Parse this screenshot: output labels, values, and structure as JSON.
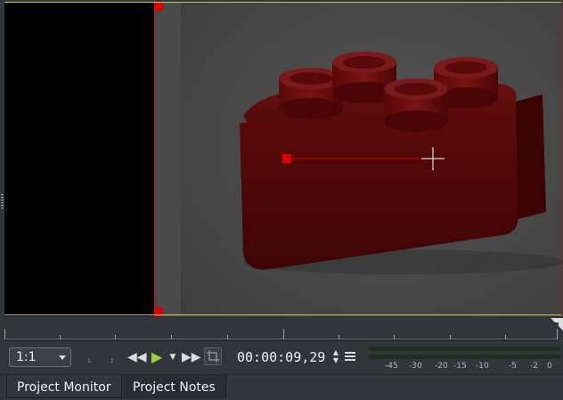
{
  "monitor": {
    "background_color": "#4a4a4a",
    "crop_edge_color": "#cc0000",
    "subject_color": "#6a0a0a"
  },
  "toolbar": {
    "zoom": "1:1",
    "timecode": "00:00:09,29",
    "icons": [
      "zone-in-icon",
      "zone-out-icon",
      "rewind-icon",
      "play-icon",
      "play-options-icon",
      "fast-forward-icon",
      "crop-icon",
      "spin-up-icon",
      "spin-down-icon",
      "menu-icon"
    ]
  },
  "audio_meter": {
    "labels": [
      "-45",
      "-30",
      "-20",
      "-15",
      "-10",
      "-5",
      "-2",
      "0"
    ],
    "color": "#1f2e24"
  },
  "tabs": [
    {
      "label": "Project Monitor",
      "active": true
    },
    {
      "label": "Project Notes",
      "active": false
    }
  ]
}
